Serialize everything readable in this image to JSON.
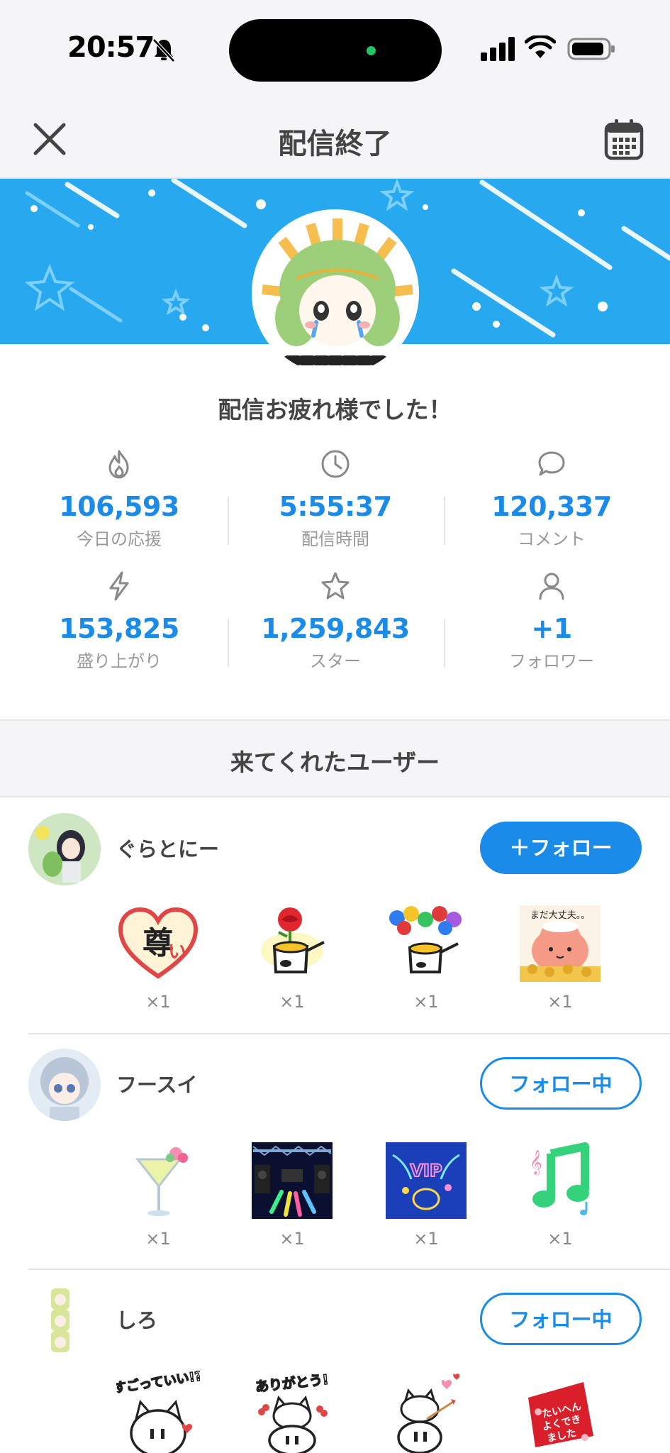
{
  "status_bar": {
    "time": "20:57"
  },
  "header": {
    "title": "配信終了"
  },
  "summary": {
    "greeting": "配信お疲れ様でした！",
    "stats": [
      {
        "icon": "flame-icon",
        "value": "106,593",
        "label": "今日の応援"
      },
      {
        "icon": "clock-icon",
        "value": "5:55:37",
        "label": "配信時間"
      },
      {
        "icon": "comment-icon",
        "value": "120,337",
        "label": "コメント"
      },
      {
        "icon": "lightning-icon",
        "value": "153,825",
        "label": "盛り上がり"
      },
      {
        "icon": "star-icon",
        "value": "1,259,843",
        "label": "スター"
      },
      {
        "icon": "person-icon",
        "value": "+1",
        "label": "フォロワー"
      }
    ]
  },
  "visitors": {
    "title": "来てくれたユーザー",
    "users": [
      {
        "name": "ぐらとにー",
        "button": "＋フォロー",
        "gifts": [
          {
            "name": "heart-kanji-gift",
            "count": "×1"
          },
          {
            "name": "rose-pot-gift",
            "count": "×1"
          },
          {
            "name": "balloon-pot-gift",
            "count": "×1"
          },
          {
            "name": "cat-coins-gift",
            "count": "×1"
          }
        ]
      },
      {
        "name": "フースイ",
        "button": "フォロー中",
        "gifts": [
          {
            "name": "cocktail-gift",
            "count": "×1"
          },
          {
            "name": "stage-gift",
            "count": "×1"
          },
          {
            "name": "vip-gift",
            "count": "×1"
          },
          {
            "name": "music-note-gift",
            "count": "×1"
          }
        ]
      },
      {
        "name": "しろ",
        "button": "フォロー中",
        "gifts": [
          {
            "name": "cat-sticker-1",
            "count": ""
          },
          {
            "name": "cat-sticker-2",
            "count": ""
          },
          {
            "name": "cat-sticker-3",
            "count": ""
          },
          {
            "name": "red-card-gift",
            "count": ""
          }
        ]
      }
    ]
  },
  "colors": {
    "accent": "#1a8be8",
    "banner": "#27a8ef",
    "band": "#f5f5f7"
  }
}
